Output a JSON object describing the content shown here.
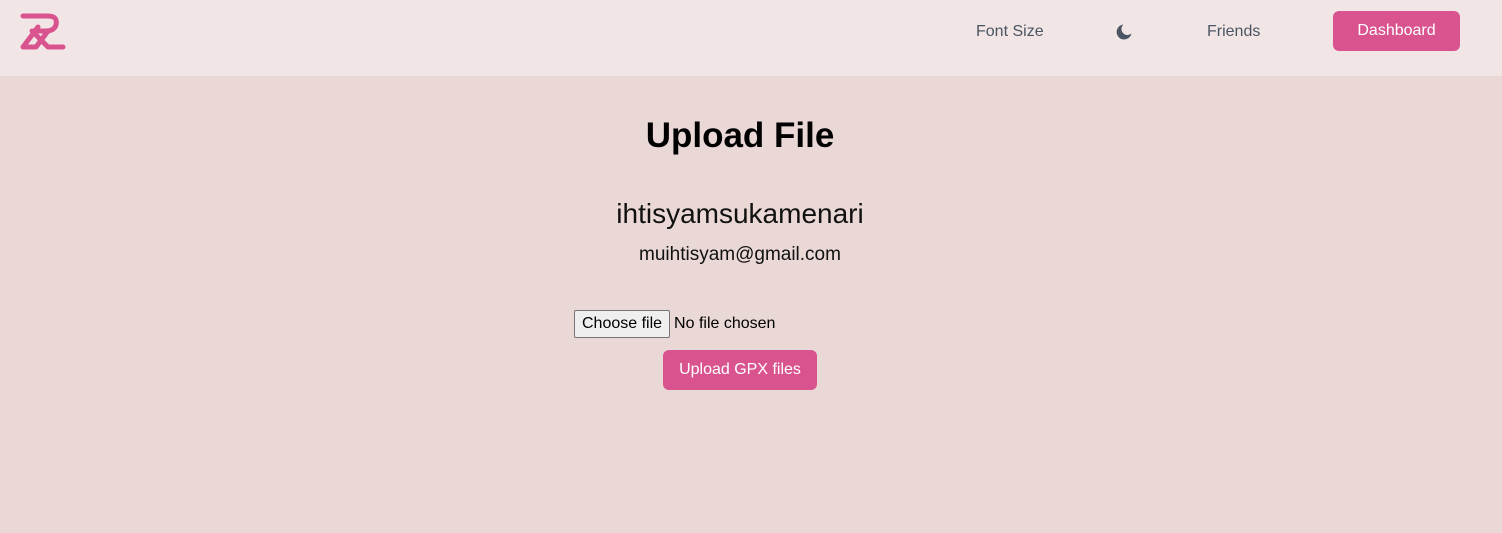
{
  "navbar": {
    "logo_icon": "brand-logo-icon",
    "font_size_label": "Font Size",
    "theme_icon": "moon-icon",
    "friends_label": "Friends",
    "dashboard_label": "Dashboard"
  },
  "main": {
    "title": "Upload File",
    "username": "ihtisyamsukamenari",
    "email": "muihtisyam@gmail.com",
    "file_input": {
      "button_label": "Choose file",
      "status": "No file chosen"
    },
    "upload_button_label": "Upload GPX files"
  },
  "colors": {
    "accent": "#d9548f",
    "navbar_bg": "#f1e6e5",
    "page_bg": "#e9d8d6"
  }
}
